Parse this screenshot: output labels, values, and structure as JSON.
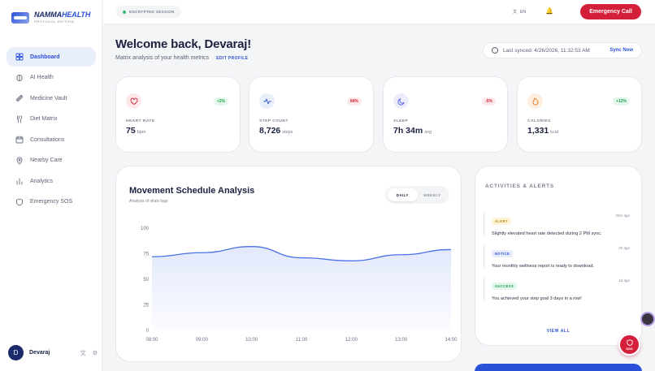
{
  "brand": {
    "name_part1": "NAMMA",
    "name_part2": "HEALTH",
    "subtitle": "PROTOCOL EDITION"
  },
  "sidebar": {
    "items": [
      {
        "label": "Dashboard",
        "icon": "grid-icon",
        "active": true
      },
      {
        "label": "AI Health",
        "icon": "brain-icon",
        "active": false
      },
      {
        "label": "Medicine Vault",
        "icon": "pill-icon",
        "active": false
      },
      {
        "label": "Diet Matrix",
        "icon": "utensils-icon",
        "active": false
      },
      {
        "label": "Consultations",
        "icon": "calendar-icon",
        "active": false
      },
      {
        "label": "Nearby Care",
        "icon": "map-pin-icon",
        "active": false
      },
      {
        "label": "Analytics",
        "icon": "bar-chart-icon",
        "active": false
      },
      {
        "label": "Emergency SOS",
        "icon": "shield-icon",
        "active": false
      }
    ],
    "user": {
      "initial": "D",
      "name": "Devaraj"
    }
  },
  "topbar": {
    "encrypted": "ENCRYPTED SESSION",
    "lang": "EN",
    "emergency": "Emergency Call"
  },
  "header": {
    "welcome": "Welcome back, Devaraj!",
    "subtitle": "Matrix analysis of your health metrics",
    "edit_profile": "EDIT PROFILE",
    "last_synced": "Last synced: 4/26/2026, 11:32:53 AM",
    "sync_now": "Sync Now"
  },
  "metrics": [
    {
      "label": "HEART RATE",
      "value": "75",
      "unit": "bpm",
      "trend": "+2%",
      "dir": "up",
      "icon": "heart-icon",
      "color": "#d41f3a",
      "bg": "#fde8ea"
    },
    {
      "label": "STEP COUNT",
      "value": "8,726",
      "unit": "steps",
      "trend": "84%",
      "dir": "down",
      "icon": "activity-icon",
      "color": "#2b50d8",
      "bg": "#e9eefb"
    },
    {
      "label": "SLEEP",
      "value": "7h 34m",
      "unit": "avg",
      "trend": "-5%",
      "dir": "down",
      "icon": "moon-icon",
      "color": "#4e5de0",
      "bg": "#eceefc"
    },
    {
      "label": "CALORIES",
      "value": "1,331",
      "unit": "kcal",
      "trend": "+12%",
      "dir": "up",
      "icon": "flame-icon",
      "color": "#e0731f",
      "bg": "#fdeee0"
    }
  ],
  "chart_panel": {
    "title": "Movement Schedule Analysis",
    "subtitle": "Analysis of vitals logs",
    "daily": "DAILY",
    "weekly": "WEEKLY"
  },
  "chart_data": {
    "type": "area",
    "x": [
      "08:00",
      "09:00",
      "10:00",
      "11:00",
      "12:00",
      "13:00",
      "14:00"
    ],
    "series": [
      {
        "values": [
          72,
          76,
          82,
          71,
          68,
          74,
          79
        ]
      }
    ],
    "yticks": [
      0,
      25,
      50,
      75,
      100
    ],
    "ylim": [
      0,
      100
    ],
    "color": "#4a72e8",
    "grid": false
  },
  "activities": {
    "title": "ACTIVITIES & ALERTS",
    "items": [
      {
        "badge": "ALERT",
        "kind": "alert",
        "time": "20m ago",
        "msg": "Slightly elevated heart rate detected during 2 PM sync."
      },
      {
        "badge": "NOTICE",
        "kind": "notice",
        "time": "2h ago",
        "msg": "Your monthly wellness report is ready to download."
      },
      {
        "badge": "SUCCESS",
        "kind": "success",
        "time": "1d ago",
        "msg": "You achieved your step goal 3 days in a row!"
      }
    ],
    "view_all": "VIEW ALL"
  },
  "sos": {
    "label": "SOS"
  }
}
